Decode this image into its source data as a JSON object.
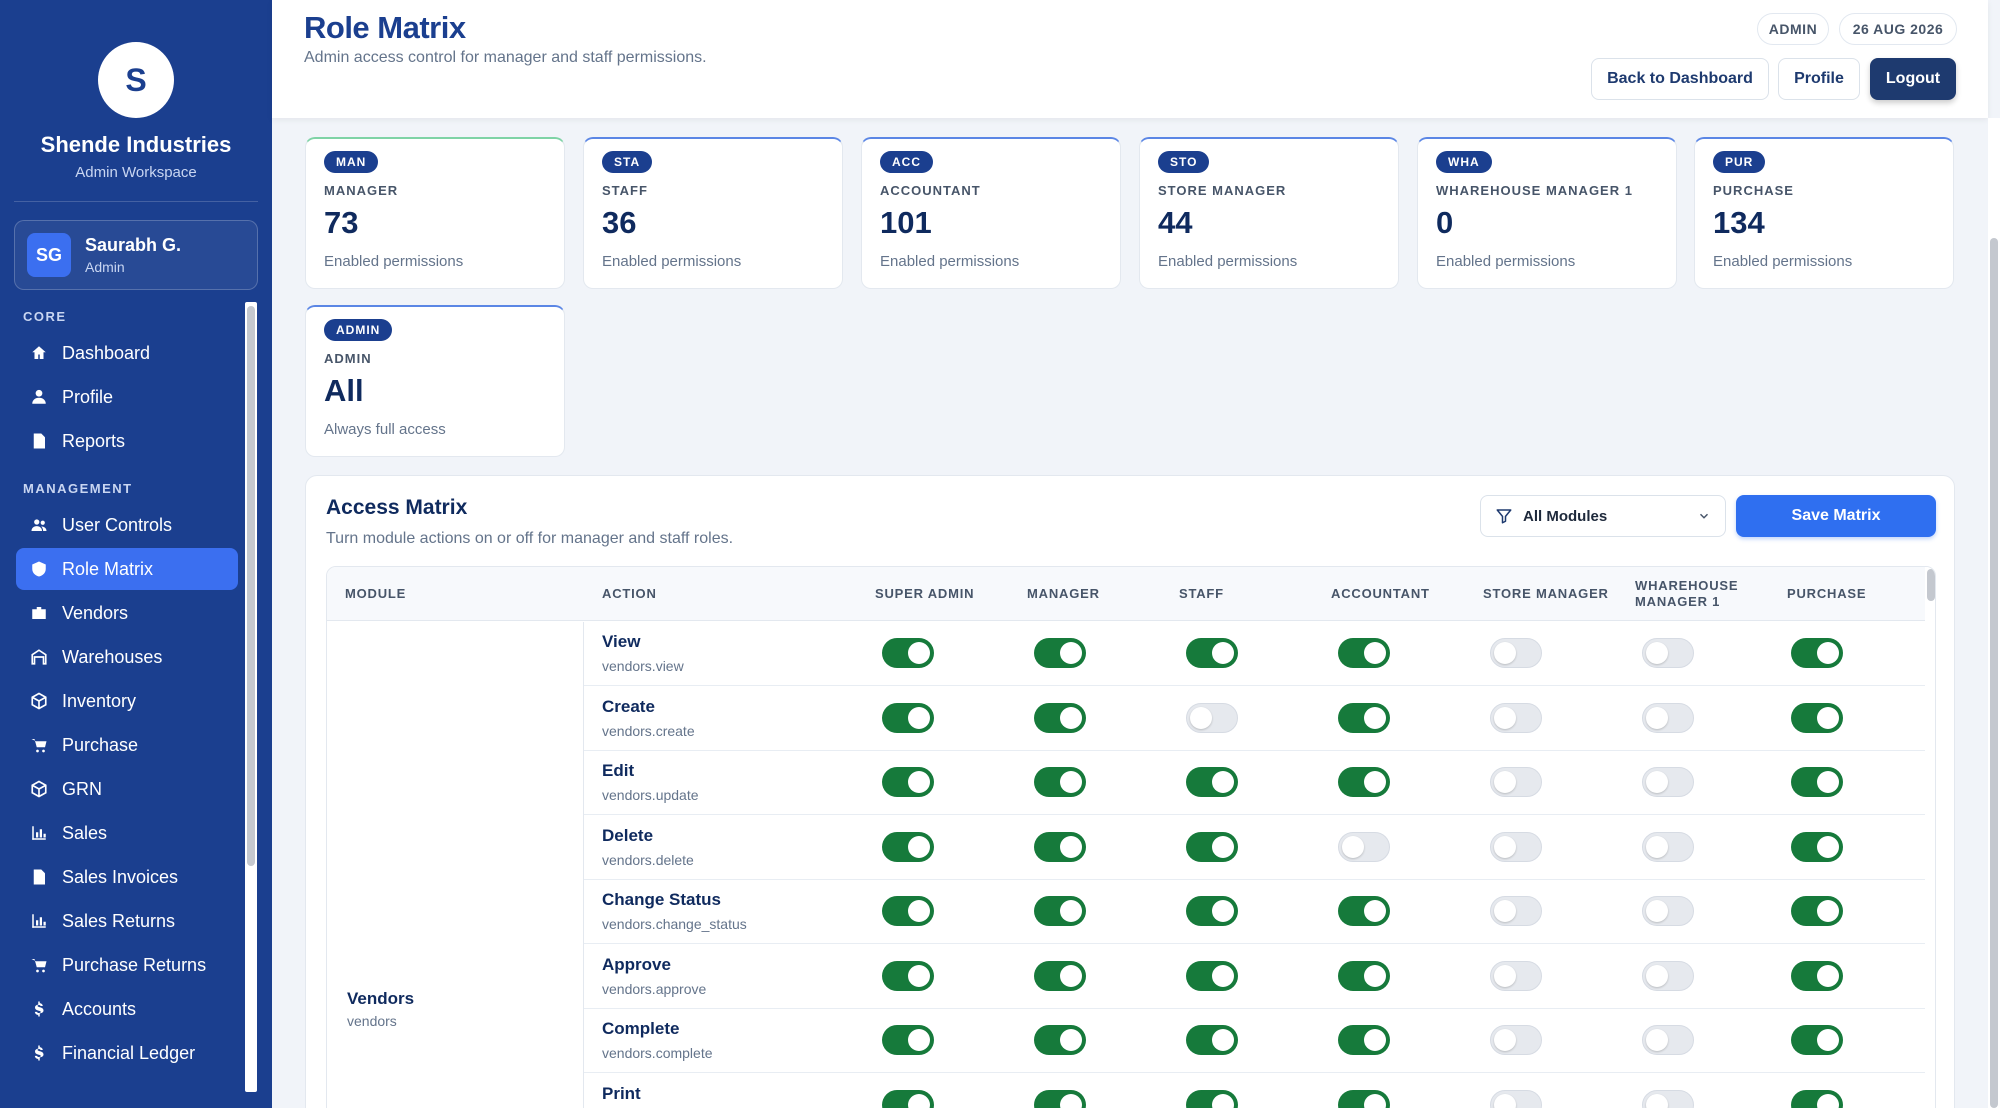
{
  "brand": {
    "logo_letter": "S",
    "name": "Shende Industries",
    "subtitle": "Admin Workspace"
  },
  "user": {
    "initials": "SG",
    "name": "Saurabh G.",
    "role": "Admin"
  },
  "sidebar": {
    "core_label": "CORE",
    "core_items": [
      {
        "label": "Dashboard",
        "icon": "home-icon"
      },
      {
        "label": "Profile",
        "icon": "user-icon"
      },
      {
        "label": "Reports",
        "icon": "document-icon"
      }
    ],
    "management_label": "MANAGEMENT",
    "management_items": [
      {
        "label": "User Controls",
        "icon": "users-icon",
        "active": false
      },
      {
        "label": "Role Matrix",
        "icon": "shield-icon",
        "active": true
      },
      {
        "label": "Vendors",
        "icon": "briefcase-icon",
        "active": false
      },
      {
        "label": "Warehouses",
        "icon": "warehouse-icon",
        "active": false
      },
      {
        "label": "Inventory",
        "icon": "cube-icon",
        "active": false
      },
      {
        "label": "Purchase",
        "icon": "cart-icon",
        "active": false
      },
      {
        "label": "GRN",
        "icon": "cube-icon",
        "active": false
      },
      {
        "label": "Sales",
        "icon": "bar-chart-icon",
        "active": false
      },
      {
        "label": "Sales Invoices",
        "icon": "document-icon",
        "active": false
      },
      {
        "label": "Sales Returns",
        "icon": "bar-chart-icon",
        "active": false
      },
      {
        "label": "Purchase Returns",
        "icon": "cart-icon",
        "active": false
      },
      {
        "label": "Accounts",
        "icon": "dollar-icon",
        "active": false
      },
      {
        "label": "Financial Ledger",
        "icon": "dollar-icon",
        "active": false
      }
    ]
  },
  "header": {
    "title": "Role Matrix",
    "subtitle": "Admin access control for manager and staff permissions.",
    "role_pill": "ADMIN",
    "date_pill": "26 AUG 2026",
    "back_label": "Back to Dashboard",
    "profile_label": "Profile",
    "logout_label": "Logout"
  },
  "stats": [
    {
      "badge": "MAN",
      "label": "MANAGER",
      "value": "73",
      "note": "Enabled permissions"
    },
    {
      "badge": "STA",
      "label": "STAFF",
      "value": "36",
      "note": "Enabled permissions"
    },
    {
      "badge": "ACC",
      "label": "ACCOUNTANT",
      "value": "101",
      "note": "Enabled permissions"
    },
    {
      "badge": "STO",
      "label": "STORE MANAGER",
      "value": "44",
      "note": "Enabled permissions"
    },
    {
      "badge": "WHA",
      "label": "WHAREHOUSE MANAGER 1",
      "value": "0",
      "note": "Enabled permissions"
    },
    {
      "badge": "PUR",
      "label": "PURCHASE",
      "value": "134",
      "note": "Enabled permissions"
    },
    {
      "badge": "ADMIN",
      "label": "ADMIN",
      "value": "All",
      "note": "Always full access"
    }
  ],
  "matrix": {
    "title": "Access Matrix",
    "subtitle": "Turn module actions on or off for manager and staff roles.",
    "filter_label": "All Modules",
    "save_label": "Save Matrix",
    "columns": {
      "module": "MODULE",
      "action": "ACTION",
      "roles": [
        "SUPER ADMIN",
        "MANAGER",
        "STAFF",
        "ACCOUNTANT",
        "STORE MANAGER",
        "WHAREHOUSE MANAGER 1",
        "PURCHASE"
      ]
    },
    "module": {
      "name": "Vendors",
      "key": "vendors"
    },
    "rows": [
      {
        "name": "View",
        "key": "vendors.view",
        "toggles": [
          true,
          true,
          true,
          true,
          false,
          false,
          true
        ]
      },
      {
        "name": "Create",
        "key": "vendors.create",
        "toggles": [
          true,
          true,
          false,
          true,
          false,
          false,
          true
        ]
      },
      {
        "name": "Edit",
        "key": "vendors.update",
        "toggles": [
          true,
          true,
          true,
          true,
          false,
          false,
          true
        ]
      },
      {
        "name": "Delete",
        "key": "vendors.delete",
        "toggles": [
          true,
          true,
          true,
          false,
          false,
          false,
          true
        ]
      },
      {
        "name": "Change Status",
        "key": "vendors.change_status",
        "toggles": [
          true,
          true,
          true,
          true,
          false,
          false,
          true
        ]
      },
      {
        "name": "Approve",
        "key": "vendors.approve",
        "toggles": [
          true,
          true,
          true,
          true,
          false,
          false,
          true
        ]
      },
      {
        "name": "Complete",
        "key": "vendors.complete",
        "toggles": [
          true,
          true,
          true,
          true,
          false,
          false,
          true
        ]
      },
      {
        "name": "Print",
        "key": "",
        "toggles": [
          true,
          true,
          true,
          true,
          false,
          false,
          true
        ]
      }
    ]
  },
  "colors": {
    "sidebar": "#1b3f8f",
    "accent": "#2f6ff0",
    "toggle_on": "#167a3b",
    "toggle_off": "#e6e9ee"
  }
}
